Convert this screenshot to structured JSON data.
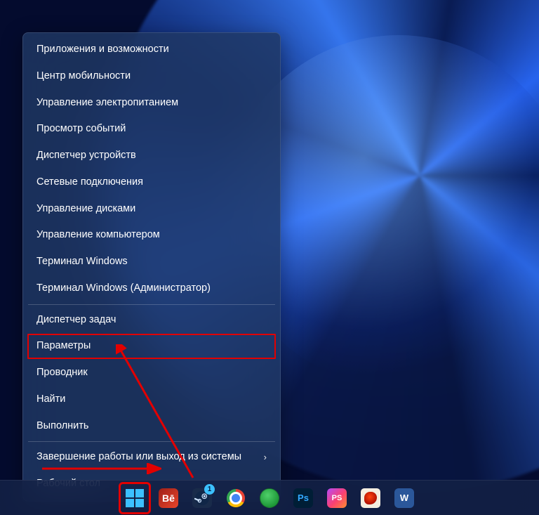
{
  "menu": {
    "groups": [
      [
        {
          "label": "Приложения и возможности"
        },
        {
          "label": "Центр мобильности"
        },
        {
          "label": "Управление электропитанием"
        },
        {
          "label": "Просмотр событий"
        },
        {
          "label": "Диспетчер устройств"
        },
        {
          "label": "Сетевые подключения"
        },
        {
          "label": "Управление дисками"
        },
        {
          "label": "Управление компьютером"
        },
        {
          "label": "Терминал Windows"
        },
        {
          "label": "Терминал Windows (Администратор)"
        }
      ],
      [
        {
          "label": "Диспетчер задач"
        },
        {
          "label": "Параметры",
          "highlighted": true
        },
        {
          "label": "Проводник"
        },
        {
          "label": "Найти"
        },
        {
          "label": "Выполнить"
        }
      ],
      [
        {
          "label": "Завершение работы или выход из системы",
          "submenu": true
        },
        {
          "label": "Рабочий стол"
        }
      ]
    ]
  },
  "taskbar": {
    "start_highlighted": true,
    "steam_badge": "1",
    "icons": {
      "start": "start-icon",
      "bihance": "Bē",
      "ps": "Ps",
      "phpstorm": "PS",
      "word": "W"
    }
  }
}
